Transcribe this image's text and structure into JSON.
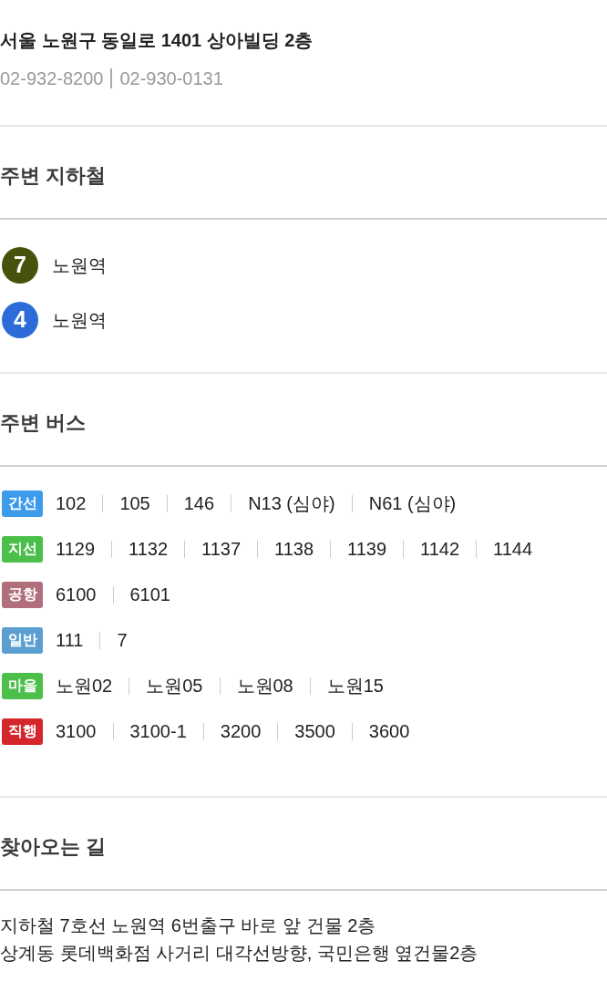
{
  "address": "서울 노원구 동일로 1401 상아빌딩 2층",
  "phones": [
    "02-932-8200",
    "02-930-0131"
  ],
  "subway": {
    "title": "주변 지하철",
    "stations": [
      {
        "line": "7",
        "name": "노원역",
        "color": "#45530c"
      },
      {
        "line": "4",
        "name": "노원역",
        "color": "#2c6bd8"
      }
    ]
  },
  "bus": {
    "title": "주변 버스",
    "routes": [
      {
        "type": "간선",
        "color": "#3d9bec",
        "numbers": [
          "102",
          "105",
          "146",
          "N13 (심야)",
          "N61 (심야)"
        ]
      },
      {
        "type": "지선",
        "color": "#4bbf4a",
        "numbers": [
          "1129",
          "1132",
          "1137",
          "1138",
          "1139",
          "1142",
          "1144"
        ]
      },
      {
        "type": "공항",
        "color": "#b16f7c",
        "numbers": [
          "6100",
          "6101"
        ]
      },
      {
        "type": "일반",
        "color": "#5a9fd0",
        "numbers": [
          "111",
          "7"
        ]
      },
      {
        "type": "마을",
        "color": "#4bbf4a",
        "numbers": [
          "노원02",
          "노원05",
          "노원08",
          "노원15"
        ]
      },
      {
        "type": "직행",
        "color": "#d4262b",
        "numbers": [
          "3100",
          "3100-1",
          "3200",
          "3500",
          "3600"
        ]
      }
    ]
  },
  "directions": {
    "title": "찾아오는 길",
    "lines": [
      "지하철 7호선 노원역 6번출구 바로 앞 건물 2층",
      "상계동 롯데백화점 사거리 대각선방향, 국민은행 옆건물2층"
    ]
  }
}
